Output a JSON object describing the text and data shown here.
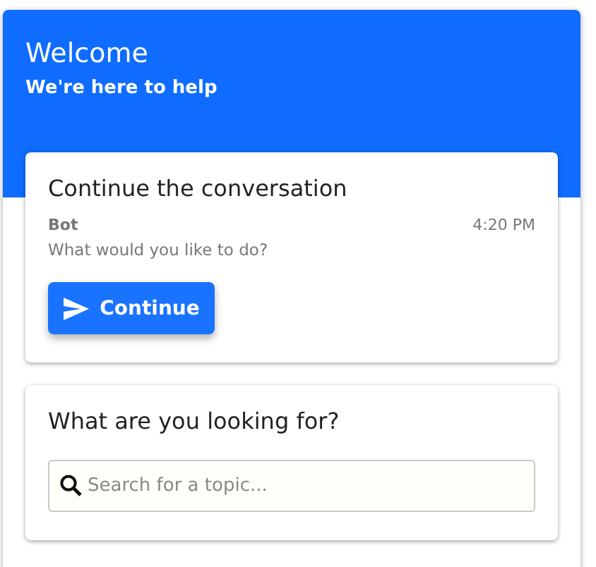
{
  "header": {
    "title": "Welcome",
    "subtitle": "We're here to help"
  },
  "conversation_card": {
    "title": "Continue the conversation",
    "sender": "Bot",
    "time": "4:20 PM",
    "message": "What would you like to do?",
    "button": "Continue"
  },
  "search_card": {
    "title": "What are you looking for?",
    "search": {
      "placeholder": "Search for a topic..."
    }
  }
}
